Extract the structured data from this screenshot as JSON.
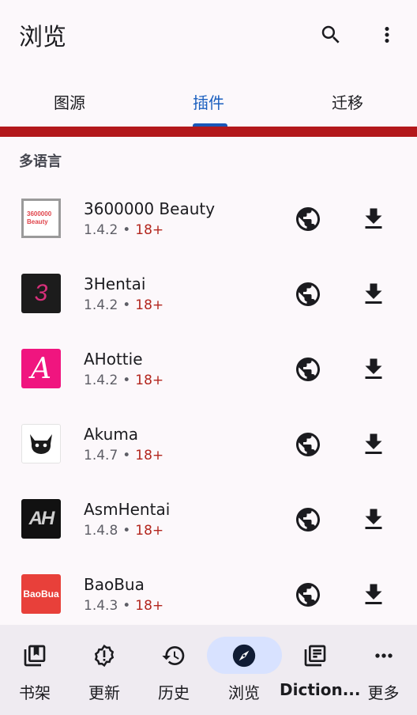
{
  "header": {
    "title": "浏览"
  },
  "tabs": [
    {
      "label": "图源",
      "active": false
    },
    {
      "label": "插件",
      "active": true
    },
    {
      "label": "迁移",
      "active": false
    }
  ],
  "section": {
    "label": "多语言"
  },
  "extensions": [
    {
      "name": "3600000 Beauty",
      "version": "1.4.2",
      "nsfw": "18+",
      "logo_text": "3600000 Beauty",
      "globe_icon": "language-globe-icon",
      "download_icon": "download-icon"
    },
    {
      "name": "3Hentai",
      "version": "1.4.2",
      "nsfw": "18+",
      "logo_text": "3",
      "globe_icon": "language-globe-icon",
      "download_icon": "download-icon"
    },
    {
      "name": "AHottie",
      "version": "1.4.2",
      "nsfw": "18+",
      "logo_text": "A",
      "globe_icon": "language-globe-icon",
      "download_icon": "download-icon"
    },
    {
      "name": "Akuma",
      "version": "1.4.7",
      "nsfw": "18+",
      "logo_text": "",
      "globe_icon": "language-globe-icon",
      "download_icon": "download-icon"
    },
    {
      "name": "AsmHentai",
      "version": "1.4.8",
      "nsfw": "18+",
      "logo_text": "AH",
      "globe_icon": "language-globe-icon",
      "download_icon": "download-icon"
    },
    {
      "name": "BaoBua",
      "version": "1.4.3",
      "nsfw": "18+",
      "logo_text": "BaoBua",
      "globe_icon": "language-globe-icon",
      "download_icon": "download-icon"
    }
  ],
  "bottom_nav": [
    {
      "label": "书架",
      "icon": "library-bookmark-icon",
      "active": false
    },
    {
      "label": "更新",
      "icon": "updates-alert-icon",
      "active": false
    },
    {
      "label": "历史",
      "icon": "history-icon",
      "active": false
    },
    {
      "label": "浏览",
      "icon": "explore-compass-icon",
      "active": true
    },
    {
      "label": "Diction...",
      "icon": "dictionary-icon",
      "active": false
    },
    {
      "label": "更多",
      "icon": "more-horiz-icon",
      "active": false
    }
  ],
  "colors": {
    "accent": "#1a57b8",
    "nsfw": "#b3261e",
    "banner": "#b3181b",
    "nav_active_pill": "#d8e2ff"
  }
}
